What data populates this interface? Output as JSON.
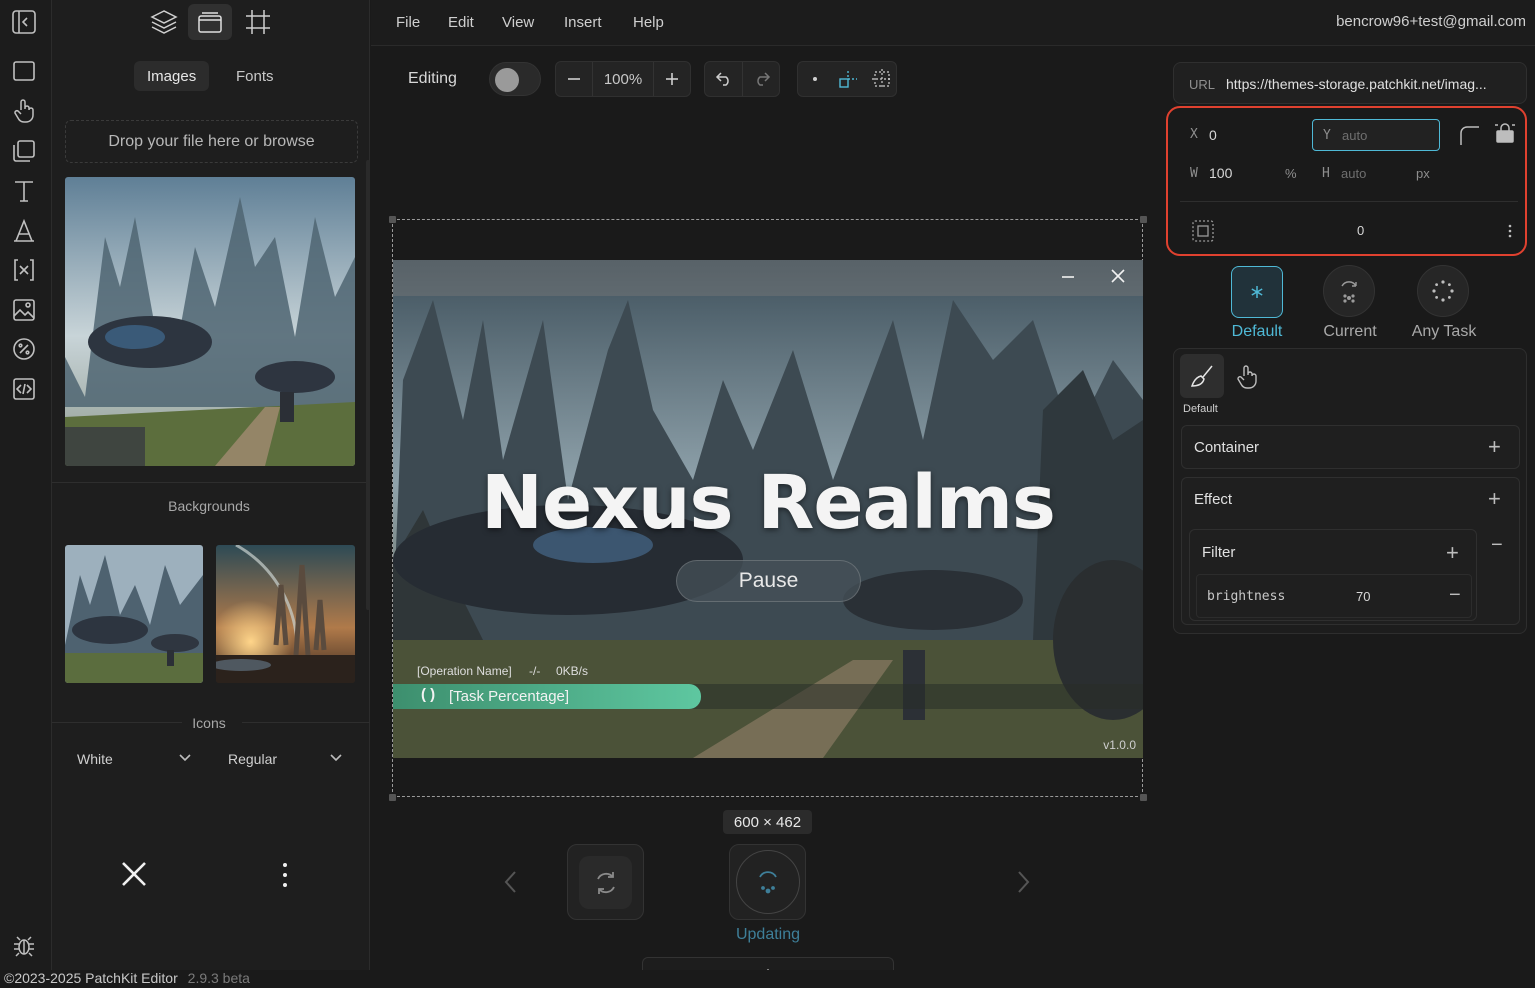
{
  "menu": {
    "items": [
      "File",
      "Edit",
      "View",
      "Insert",
      "Help"
    ],
    "user_email": "bencrow96+test@gmail.com"
  },
  "left_panel": {
    "tabs": [
      "Images",
      "Fonts"
    ],
    "active_tab": "Images",
    "dropzone_text": "Drop your file here or browse",
    "backgrounds_label": "Backgrounds",
    "icons_label": "Icons",
    "icon_color": "White",
    "icon_style": "Regular"
  },
  "toolbar": {
    "mode_label": "Editing",
    "zoom": "100%"
  },
  "canvas": {
    "title": "Nexus Realms",
    "pause_label": "Pause",
    "operation_name": "[Operation Name]",
    "speed_sep": "-/-",
    "speed": "0KB/s",
    "task_percentage": "[Task Percentage]",
    "version": "v1.0.0",
    "size_badge": "600 × 462",
    "progress": 0.41
  },
  "bottom_preview": {
    "updating_label": "Updating"
  },
  "right_panel": {
    "url_label": "URL",
    "url_value": "https://themes-storage.patchkit.net/imag...",
    "x_label": "X",
    "x_value": "0",
    "y_label": "Y",
    "y_placeholder": "auto",
    "w_label": "W",
    "w_value": "100",
    "w_unit": "%",
    "h_label": "H",
    "h_placeholder": "auto",
    "h_unit": "px",
    "padding_value": "0",
    "states": [
      "Default",
      "Current",
      "Any Task"
    ],
    "style_tab_label": "Default",
    "container_label": "Container",
    "effect_label": "Effect",
    "filter_label": "Filter",
    "filter_prop": "brightness",
    "filter_value": "70"
  },
  "footer": {
    "copyright": "©2023-2025 PatchKit Editor",
    "version": "2.9.3 beta"
  },
  "colors": {
    "accent": "#4fb9d6",
    "highlight_ring": "#e0412f",
    "progress_start": "#3d8f6e",
    "progress_end": "#5ec7a0"
  }
}
